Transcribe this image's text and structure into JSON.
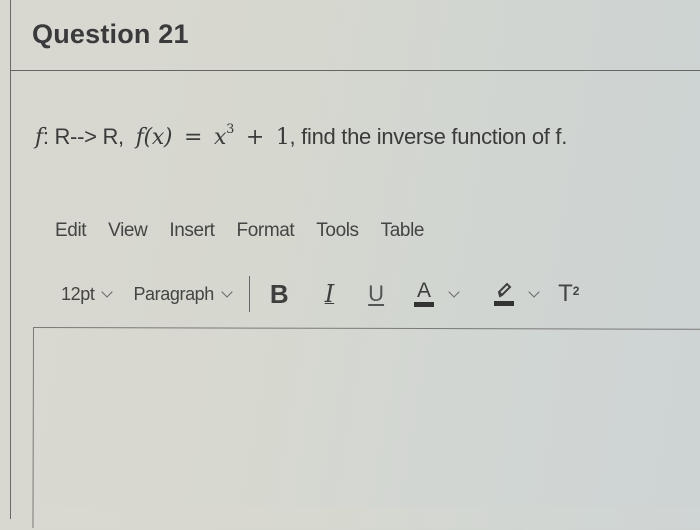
{
  "question": {
    "title": "Question 21",
    "text_parts": {
      "f_symbol": "f",
      "mapping": ": R--> R,",
      "f_of_x": "f(x)",
      "equals": "=",
      "x_var": "x",
      "exponent": "3",
      "plus": "+",
      "one": "1",
      "rest": ", find the inverse function of f."
    }
  },
  "editor": {
    "menubar": [
      "Edit",
      "View",
      "Insert",
      "Format",
      "Tools",
      "Table"
    ],
    "toolbar": {
      "font_size": "12pt",
      "block_format": "Paragraph",
      "bold_label": "B",
      "italic_label": "I",
      "underline_label": "U",
      "text_color_label": "A",
      "superscript_label": "T",
      "superscript_exp": "2"
    },
    "content": ""
  }
}
